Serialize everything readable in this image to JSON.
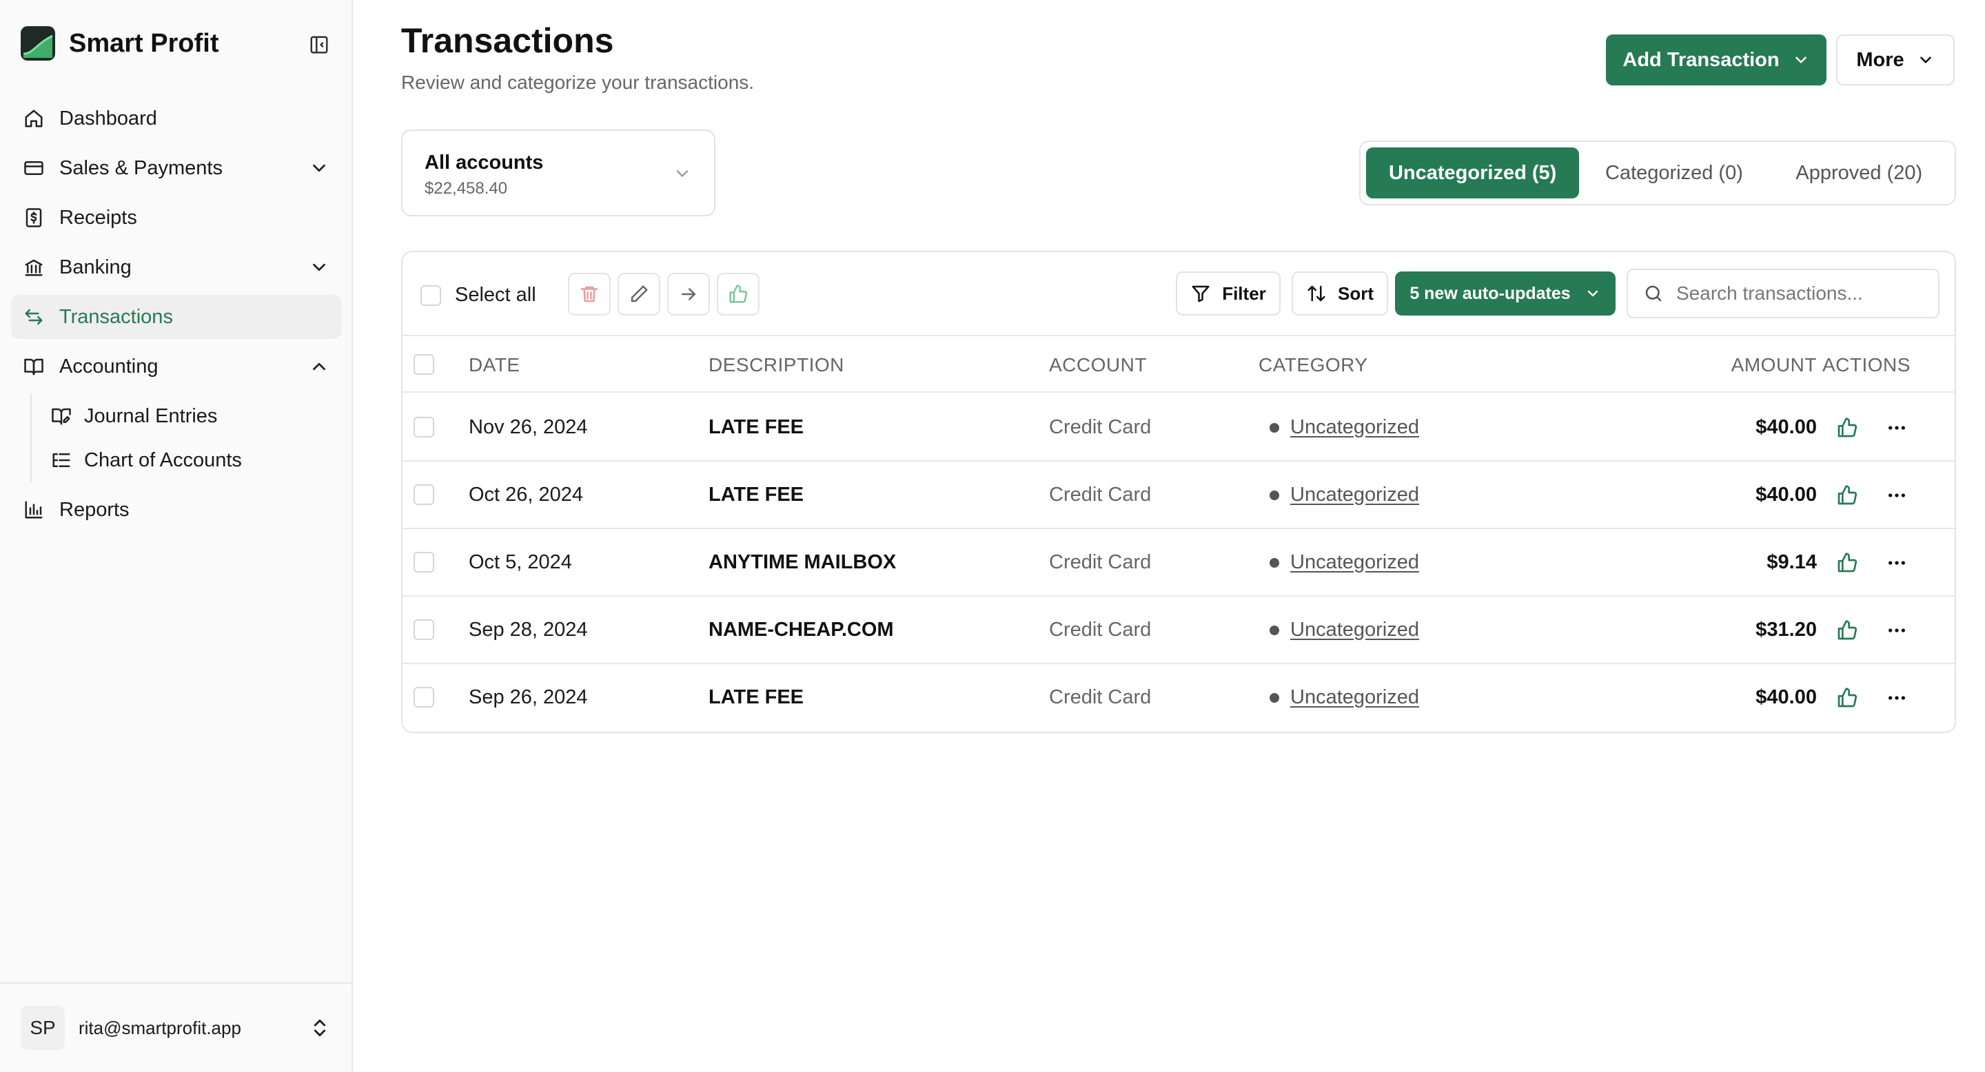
{
  "brand": {
    "name": "Smart Profit",
    "color": "#267a54"
  },
  "nav": {
    "dashboard": "Dashboard",
    "sales": "Sales & Payments",
    "receipts": "Receipts",
    "banking": "Banking",
    "transactions": "Transactions",
    "accounting": "Accounting",
    "journal": "Journal Entries",
    "chart_of_accounts": "Chart of Accounts",
    "reports": "Reports"
  },
  "user": {
    "initials": "SP",
    "email": "rita@smartprofit.app"
  },
  "header": {
    "title": "Transactions",
    "subtitle": "Review and categorize your transactions.",
    "add_label": "Add Transaction",
    "more_label": "More"
  },
  "account": {
    "name": "All accounts",
    "balance": "$22,458.40"
  },
  "status_tabs": {
    "uncategorized": "Uncategorized (5)",
    "categorized": "Categorized (0)",
    "approved": "Approved (20)"
  },
  "toolbar": {
    "select_all": "Select all",
    "filter": "Filter",
    "sort": "Sort",
    "auto_updates": "5 new auto-updates",
    "search_placeholder": "Search transactions..."
  },
  "table": {
    "headers": {
      "date": "DATE",
      "description": "DESCRIPTION",
      "account": "ACCOUNT",
      "category": "CATEGORY",
      "amount": "AMOUNT",
      "actions": "ACTIONS"
    },
    "rows": [
      {
        "date": "Nov 26, 2024",
        "description": "LATE FEE",
        "account": "Credit Card",
        "category": "Uncategorized",
        "amount": "$40.00"
      },
      {
        "date": "Oct 26, 2024",
        "description": "LATE FEE",
        "account": "Credit Card",
        "category": "Uncategorized",
        "amount": "$40.00"
      },
      {
        "date": "Oct 5, 2024",
        "description": "ANYTIME MAILBOX",
        "account": "Credit Card",
        "category": "Uncategorized",
        "amount": "$9.14"
      },
      {
        "date": "Sep 28, 2024",
        "description": "NAME-CHEAP.COM",
        "account": "Credit Card",
        "category": "Uncategorized",
        "amount": "$31.20"
      },
      {
        "date": "Sep 26, 2024",
        "description": "LATE FEE",
        "account": "Credit Card",
        "category": "Uncategorized",
        "amount": "$40.00"
      }
    ]
  }
}
